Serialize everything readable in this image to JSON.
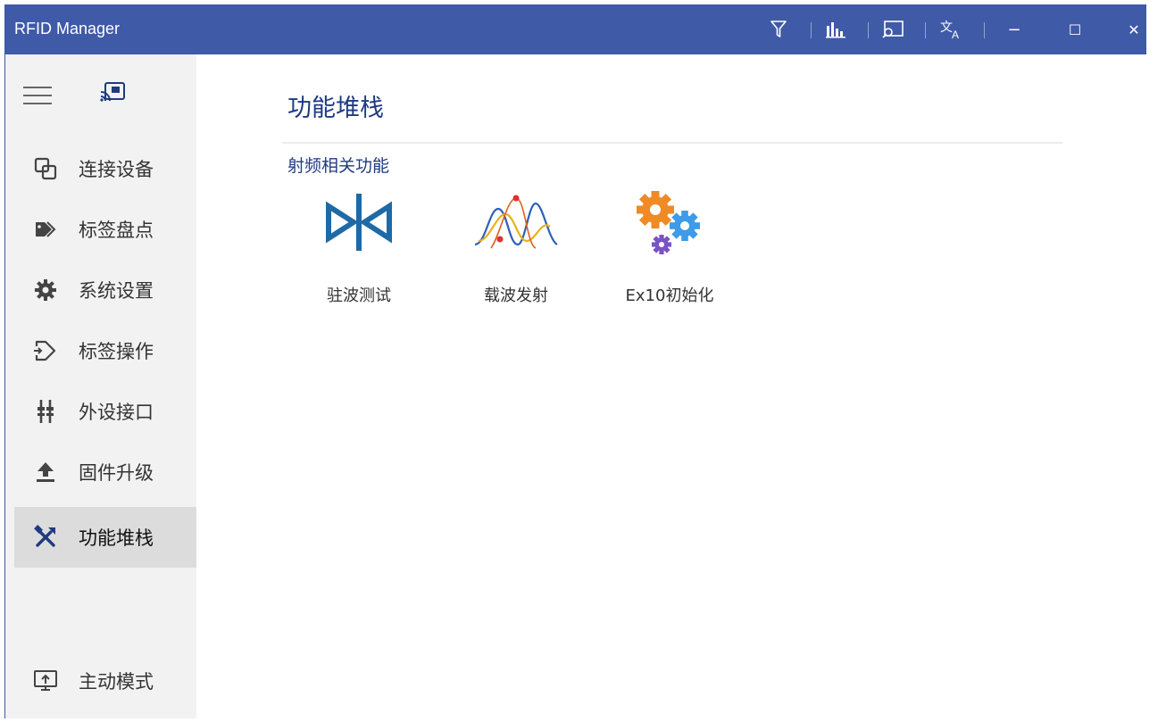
{
  "window": {
    "title": "RFID Manager"
  },
  "titlebar_tools": [
    {
      "name": "filter-icon"
    },
    {
      "name": "chart-icon"
    },
    {
      "name": "screen-search-icon"
    },
    {
      "name": "translate-icon"
    }
  ],
  "window_controls": {
    "minimize": "−",
    "maximize": "☐",
    "close": "✕"
  },
  "sidebar": {
    "items": [
      {
        "label": "连接设备",
        "icon": "connect-icon"
      },
      {
        "label": "标签盘点",
        "icon": "tag-icon"
      },
      {
        "label": "系统设置",
        "icon": "gear-icon"
      },
      {
        "label": "标签操作",
        "icon": "tag-operate-icon"
      },
      {
        "label": "外设接口",
        "icon": "peripheral-icon"
      },
      {
        "label": "固件升级",
        "icon": "upload-icon"
      },
      {
        "label": "功能堆栈",
        "icon": "tools-icon",
        "active": true
      }
    ],
    "bottom_item": {
      "label": "主动模式",
      "icon": "active-mode-icon"
    }
  },
  "main": {
    "page_title": "功能堆栈",
    "section_title": "射频相关功能",
    "functions": [
      {
        "label": "驻波测试",
        "icon": "vswr-icon"
      },
      {
        "label": "载波发射",
        "icon": "carrier-wave-icon"
      },
      {
        "label": "Ex10初始化",
        "icon": "gears-icon"
      }
    ]
  },
  "colors": {
    "titlebar": "#3f5aa7",
    "sidebar_bg": "#f2f2f2",
    "active_item": "#dcdcdc",
    "heading": "#1f3b80"
  }
}
